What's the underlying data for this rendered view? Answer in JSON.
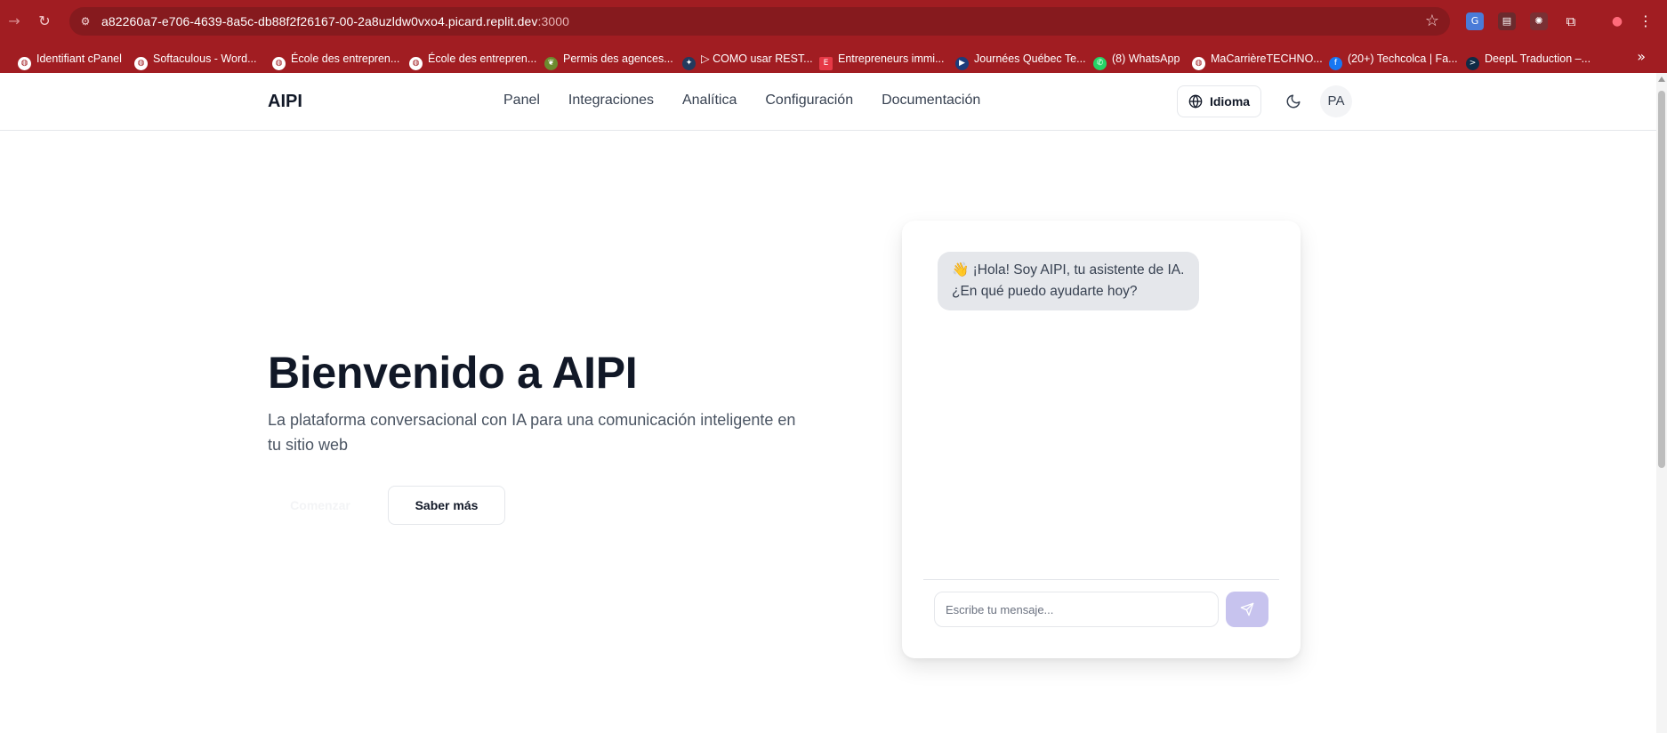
{
  "browser": {
    "url_host": "a82260a7-e706-4639-8a5c-db88f2f26167-00-2a8uzldw0vxo4.picard.replit.dev",
    "url_port": ":3000",
    "bookmarks": [
      {
        "label": "Identifiant cPanel",
        "icon": "globe-icon"
      },
      {
        "label": "Softaculous - Word...",
        "icon": "globe-icon"
      },
      {
        "label": "École des entrepren...",
        "icon": "globe-icon"
      },
      {
        "label": "École des entrepren...",
        "icon": "globe-icon"
      },
      {
        "label": "Permis des agences...",
        "icon": "leaf-icon"
      },
      {
        "label": "▷ COMO usar REST...",
        "icon": "seal-icon"
      },
      {
        "label": "Entrepreneurs immi...",
        "icon": "e-icon"
      },
      {
        "label": "Journées Québec Te...",
        "icon": "flag-icon"
      },
      {
        "label": "(8) WhatsApp",
        "icon": "whatsapp-icon"
      },
      {
        "label": "MaCarrièreTECHNO...",
        "icon": "globe-icon"
      },
      {
        "label": "(20+) Techcolca | Fa...",
        "icon": "facebook-icon"
      },
      {
        "label": "DeepL Traduction –...",
        "icon": "deepl-icon"
      }
    ]
  },
  "header": {
    "logo": "AIPI",
    "nav": [
      "Panel",
      "Integraciones",
      "Analítica",
      "Configuración",
      "Documentación"
    ],
    "language_label": "Idioma",
    "avatar_initials": "PA"
  },
  "hero": {
    "title": "Bienvenido a AIPI",
    "subtitle": "La plataforma conversacional con IA para una comunicación inteligente en tu sitio web",
    "primary_button": "Comenzar",
    "secondary_button": "Saber más"
  },
  "chat": {
    "greeting": "👋 ¡Hola! Soy AIPI, tu asistente de IA. ¿En qué puedo ayudarte hoy?",
    "input_placeholder": "Escribe tu mensaje..."
  },
  "colors": {
    "browser_chrome": "#a11d22",
    "omnibox": "#861a1e",
    "send_button": "#c7c3ee",
    "bubble": "#e5e7eb",
    "heading": "#111827"
  }
}
